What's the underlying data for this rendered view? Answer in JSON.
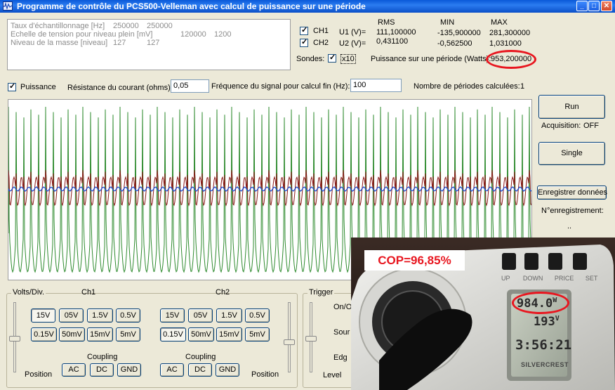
{
  "window": {
    "title": "Programme de contrôle du PCS500-Velleman avec calcul de puissance sur une période",
    "buttons": {
      "minimize": "_",
      "maximize": "□",
      "close": "✕"
    }
  },
  "info": {
    "rows": [
      {
        "label": "Taux d'échantillonnage [Hz]",
        "v1": "250000",
        "v2": "250000"
      },
      {
        "label": "Echelle de tension pour niveau plein [mV]",
        "v1": "120000",
        "v2": "1200"
      },
      {
        "label": "Niveau de la masse [niveau]",
        "v1": "127",
        "v2": "127"
      }
    ]
  },
  "measure": {
    "headers": {
      "rms": "RMS",
      "min": "MIN",
      "max": "MAX"
    },
    "ch1": {
      "label": "CH1",
      "u_label": "U1 (V)=",
      "rms": "111,100000",
      "min": "-135,900000",
      "max": "281,300000"
    },
    "ch2": {
      "label": "CH2",
      "u_label": "U2 (V)=",
      "rms": "0,431100",
      "min": "-0,562500",
      "max": "1,031000"
    },
    "probes_label": "Sondes:",
    "x10_label": "x10",
    "power_label": "Puissance sur une période (Watts):",
    "power_value": "953,200000"
  },
  "controls": {
    "puissance_label": "Puissance",
    "resistance_label": "Résistance du courant (ohms):",
    "resistance_value": "0,05",
    "freq_label": "Fréquence du signal pour calcul fin (Hz):",
    "freq_value": "100",
    "periods_label": "Nombre de périodes calculées:",
    "periods_value": "1"
  },
  "side": {
    "run": "Run",
    "acq_label": "Acquisition:",
    "acq_value": "OFF",
    "single": "Single",
    "save": "Enregistrer données",
    "rec_label": "N°enregistrement:",
    "rec_value": ".."
  },
  "bottom": {
    "volts_div": "Volts/Div.",
    "ch1": "Ch1",
    "ch2": "Ch2",
    "trigger": "Trigger",
    "onoff": "On/O",
    "source": "Sour",
    "edge": "Edg",
    "level": "Level",
    "position": "Position",
    "coupling": "Coupling",
    "volt_buttons_row1": [
      "15V",
      "05V",
      "1.5V",
      "0.5V"
    ],
    "volt_buttons_row2": [
      "0.15V",
      "50mV",
      "15mV",
      "5mV"
    ],
    "coupling_buttons": [
      "AC",
      "DC",
      "GND"
    ]
  },
  "photo": {
    "cop": "COP=96,85%",
    "meter_buttons": [
      "UP",
      "DOWN",
      "PRICE",
      "SET"
    ],
    "lcd_power": "984.0",
    "lcd_power_unit": "W",
    "lcd_voltage": "193",
    "lcd_voltage_unit": "V",
    "lcd_time": "3:56:21",
    "brand": "SILVERCREST"
  }
}
